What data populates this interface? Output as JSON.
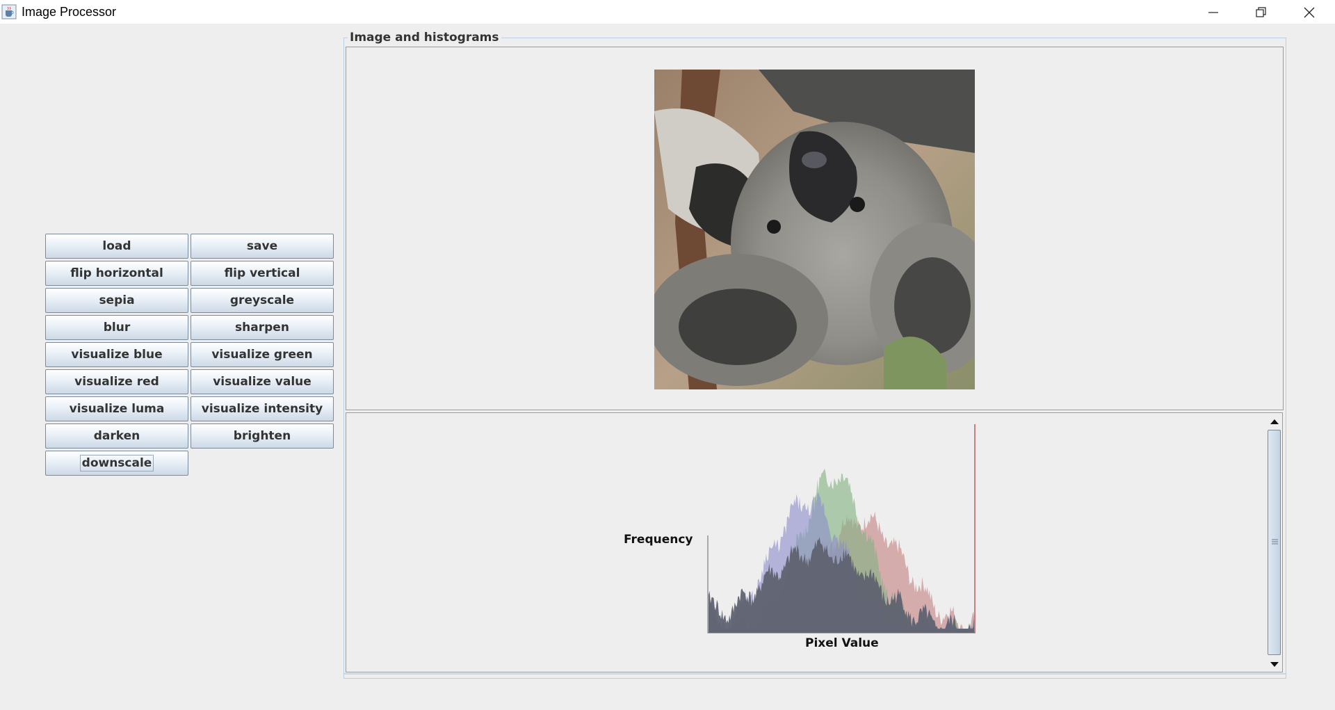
{
  "window": {
    "title": "Image Processor",
    "icons": {
      "app": "java-cup-icon",
      "minimize": "minimize-icon",
      "restore": "restore-icon",
      "close": "close-icon"
    }
  },
  "buttons": {
    "load": "load",
    "save": "save",
    "flip_horizontal": "flip horizontal",
    "flip_vertical": "flip vertical",
    "sepia": "sepia",
    "greyscale": "greyscale",
    "blur": "blur",
    "sharpen": "sharpen",
    "visualize_blue": "visualize blue",
    "visualize_green": "visualize green",
    "visualize_red": "visualize red",
    "visualize_value": "visualize value",
    "visualize_luma": "visualize luma",
    "visualize_intensity": "visualize intensity",
    "darken": "darken",
    "brighten": "brighten",
    "downscale": "downscale"
  },
  "panel": {
    "title": "Image and histograms"
  },
  "histogram": {
    "ylabel": "Frequency",
    "xlabel": "Pixel Value",
    "colors": {
      "red": "#c48080",
      "green": "#80b080",
      "blue": "#8c8ccc",
      "intensity": "#5f6270"
    }
  },
  "chart_data": {
    "type": "area",
    "xlabel": "Pixel Value",
    "ylabel": "Frequency",
    "xlim": [
      0,
      255
    ],
    "series": [
      {
        "name": "red",
        "peak_at": 145,
        "peak_rel": 0.55
      },
      {
        "name": "green",
        "peak_at": 120,
        "peak_rel": 0.77
      },
      {
        "name": "blue",
        "peak_at": 95,
        "peak_rel": 0.63
      },
      {
        "name": "intensity",
        "peak_at": 105,
        "peak_rel": 0.4
      }
    ]
  }
}
